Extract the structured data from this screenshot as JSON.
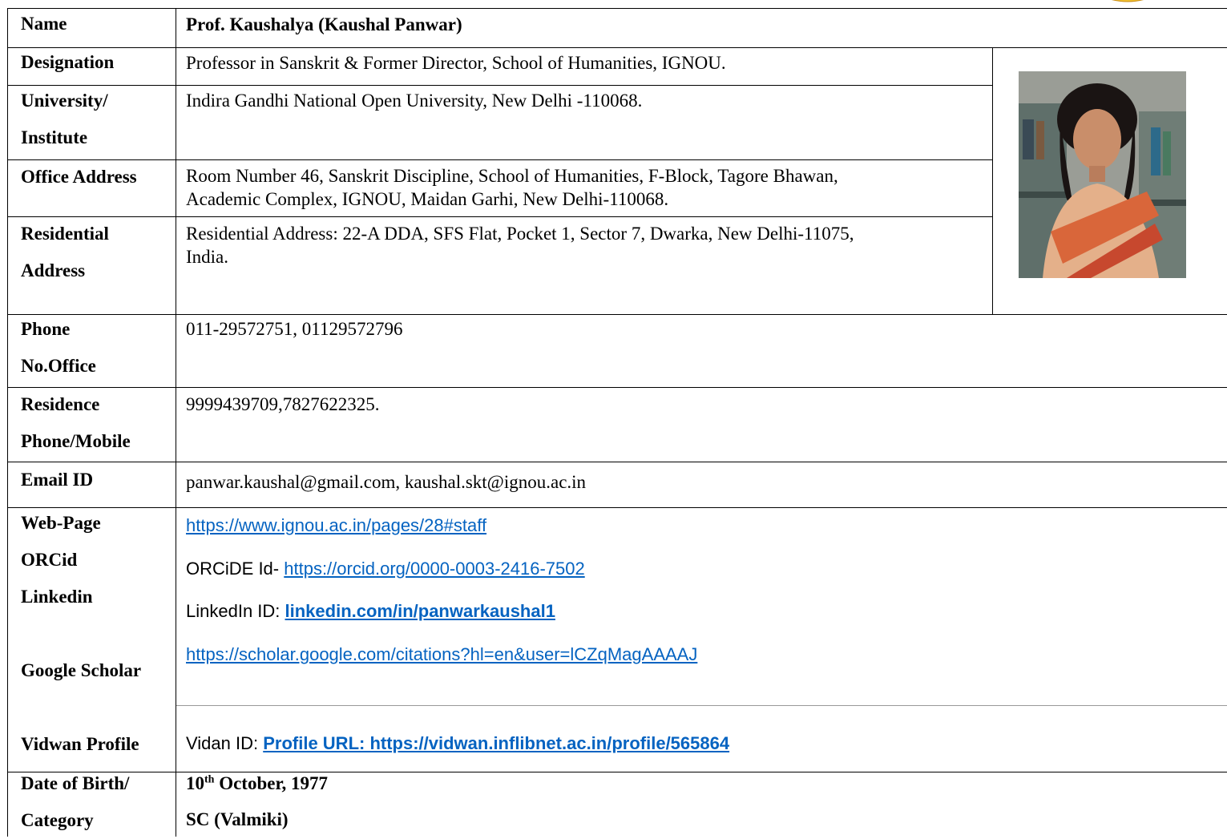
{
  "rows": {
    "name": {
      "label": "Name",
      "value": "Prof. Kaushalya (Kaushal Panwar)"
    },
    "designation": {
      "label": "Designation",
      "value": "Professor in Sanskrit & Former Director, School of Humanities, IGNOU."
    },
    "university": {
      "label_line1": "University/",
      "label_line2": "Institute",
      "value": "Indira Gandhi National Open University, New Delhi -110068."
    },
    "office_address": {
      "label": "Office Address",
      "value_line1": "Room Number 46, Sanskrit Discipline, School of Humanities, F-Block, Tagore Bhawan,",
      "value_line2": "Academic Complex, IGNOU, Maidan Garhi, New Delhi-110068."
    },
    "residential_address": {
      "label_line1": "Residential",
      "label_line2": "Address",
      "value_line1": "Residential Address: 22-A DDA, SFS Flat, Pocket 1, Sector 7, Dwarka, New Delhi-11075,",
      "value_line2": "India."
    },
    "phone_office": {
      "label_line1": "Phone",
      "label_line2": "No.Office",
      "value": "011-29572751, 01129572796"
    },
    "residence_phone": {
      "label_line1": "Residence",
      "label_line2": "Phone/Mobile",
      "value": "9999439709,7827622325."
    },
    "email": {
      "label": "Email ID",
      "value": "panwar.kaushal@gmail.com, kaushal.skt@ignou.ac.in"
    },
    "profiles": {
      "label_webpage": "Web-Page",
      "label_orcid": "ORCid",
      "label_linkedin": "Linkedin",
      "label_scholar": "Google Scholar",
      "webpage_url": "https://www.ignou.ac.in/pages/28#staff",
      "orcid_prefix": "ORCiDE Id- ",
      "orcid_url": "https://orcid.org/0000-0003-2416-7502",
      "linkedin_prefix": "LinkedIn ID: ",
      "linkedin_url": "linkedin.com/in/panwarkaushal1",
      "scholar_url": "https://scholar.google.com/citations?hl=en&user=lCZqMagAAAAJ"
    },
    "vidwan": {
      "label": "Vidwan Profile",
      "prefix": "Vidan ID: ",
      "url": "Profile URL: https://vidwan.inflibnet.ac.in/profile/565864"
    },
    "dob": {
      "label_line1": "Date of Birth/",
      "label_line2": "Category",
      "dob_day": "10",
      "dob_suffix": "th",
      "dob_rest": " October, 1977",
      "category": "SC (Valmiki)"
    }
  },
  "colors": {
    "link": "#0563c1",
    "border": "#000000"
  },
  "photo_icon": "person-photo"
}
